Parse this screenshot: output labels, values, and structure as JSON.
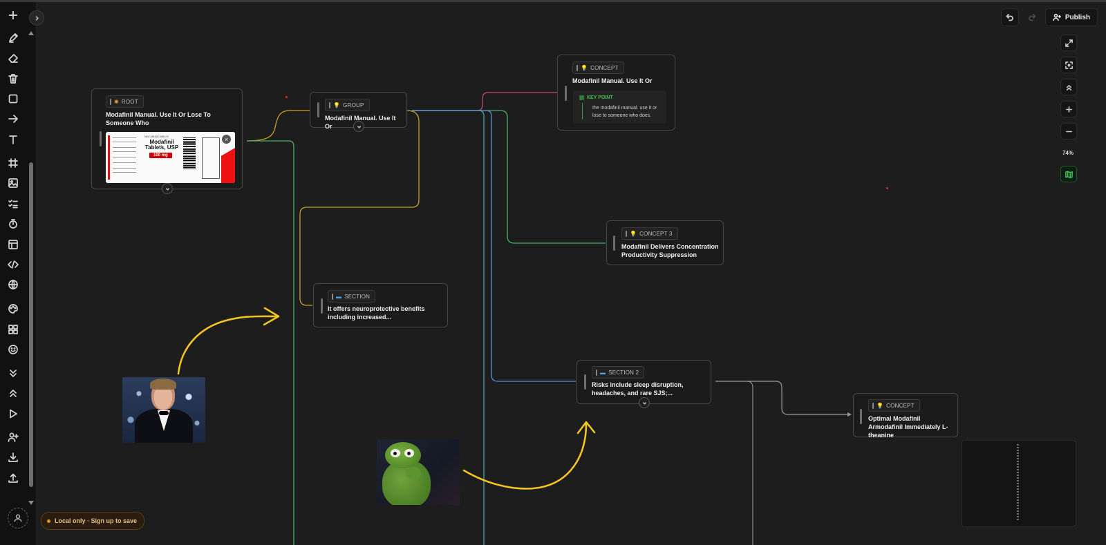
{
  "toolbar": {
    "items": [
      {
        "name": "pen-tool",
        "icon": "pen-icon"
      },
      {
        "name": "eraser-tool",
        "icon": "eraser-icon"
      },
      {
        "name": "delete-tool",
        "icon": "trash-icon"
      },
      {
        "name": "rectangle-tool",
        "icon": "square-icon"
      },
      {
        "name": "arrow-tool",
        "icon": "arrow-right-icon"
      },
      {
        "name": "text-tool",
        "icon": "text-icon"
      },
      {
        "name": "grid-tool",
        "icon": "hash-icon"
      },
      {
        "name": "image-tool",
        "icon": "image-icon"
      },
      {
        "name": "checklist-tool",
        "icon": "checklist-icon"
      },
      {
        "name": "timer-tool",
        "icon": "timer-icon"
      },
      {
        "name": "table-tool",
        "icon": "layout-icon"
      },
      {
        "name": "code-tool",
        "icon": "code-icon"
      },
      {
        "name": "web-tool",
        "icon": "globe-icon"
      },
      {
        "name": "palette-tool",
        "icon": "palette-icon"
      },
      {
        "name": "apps-tool",
        "icon": "grid-icon"
      },
      {
        "name": "emoji-tool",
        "icon": "smile-icon"
      },
      {
        "name": "collapse-all-tool",
        "icon": "chevrons-down-icon"
      },
      {
        "name": "expand-all-tool",
        "icon": "chevrons-up-icon"
      },
      {
        "name": "present-tool",
        "icon": "play-icon"
      },
      {
        "name": "share-tool",
        "icon": "user-plus-icon"
      },
      {
        "name": "download-tool",
        "icon": "download-icon"
      },
      {
        "name": "upload-tool",
        "icon": "upload-icon"
      }
    ]
  },
  "header": {
    "publish_label": "Publish"
  },
  "view": {
    "zoom": "74%"
  },
  "nodes": {
    "root": {
      "tag": "ROOT",
      "tag_icon": "sun-icon",
      "title": "Modafinil Manual. Use It Or Lose To Someone Who",
      "image": {
        "drug_name": "Modafinil Tablets, USP",
        "dose": "100 mg",
        "ndc": "NDC 65162-585-03"
      }
    },
    "group": {
      "tag": "GROUP",
      "tag_icon": "bulb-icon",
      "title": "Modafinil Manual. Use It Or"
    },
    "concept_top": {
      "tag": "CONCEPT",
      "tag_icon": "bulb-icon",
      "title": "Modafinil Manual. Use It Or",
      "key_point_label": "KEY POINT",
      "key_point_text": "the modafinil manual. use it or lose to someone who does."
    },
    "concept3": {
      "tag": "CONCEPT 3",
      "tag_icon": "bulb-icon",
      "title": "Modafinil Delivers Concentration Productivity Suppression"
    },
    "section": {
      "tag": "SECTION",
      "tag_icon": "folder-icon",
      "title": "It offers neuroprotective benefits including increased..."
    },
    "section2": {
      "tag": "SECTION 2",
      "tag_icon": "folder-icon",
      "title": "Risks include sleep disruption, headaches, and rare SJS;..."
    },
    "concept_right": {
      "tag": "CONCEPT",
      "tag_icon": "bulb-icon",
      "title": "Optimal Modafinil Armodafinil Immediately L-theanine"
    }
  },
  "status": {
    "local_label": "Local only · Sign up to save"
  },
  "colors": {
    "edge_yellow": "#c9a227",
    "edge_green": "#4caf6a",
    "edge_cyan": "#3fa7c4",
    "edge_blue": "#5a8fd6",
    "edge_red": "#c0506a",
    "edge_gray": "#9a9a9a",
    "annotation_yellow": "#f2c522",
    "accent_green": "#43c14d"
  }
}
